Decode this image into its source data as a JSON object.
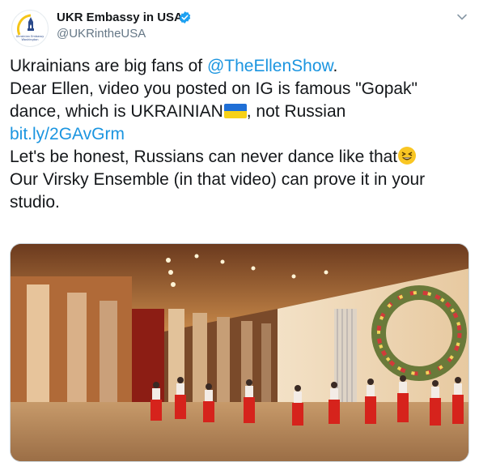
{
  "tweet": {
    "display_name": "UKR Embassy in USA",
    "handle": "@UKRintheUSA",
    "avatar_caption": "Ukrainian Embassy Washington",
    "text": {
      "line1_prefix": "Ukrainians are big fans of ",
      "mention": "@TheEllenShow",
      "line1_suffix": ".",
      "line2": "Dear Ellen, video you posted on IG is famous \"Gopak\"",
      "line3_prefix": "dance, which is UKRAINIAN",
      "line3_suffix": ", not Russian",
      "link": "bit.ly/2GAvGrm",
      "line5": "Let's be honest, Russians can never dance like that",
      "line6": "Our Virsky Ensemble (in that video) can prove it in your",
      "line7": "studio."
    },
    "emojis": [
      "ukraine-flag",
      "grinning-squinting-face"
    ],
    "media": {
      "type": "video",
      "description_icon": "video-thumbnail"
    }
  },
  "colors": {
    "text": "#14171a",
    "secondary": "#657786",
    "link": "#1b95e0",
    "verified": "#1da1f2",
    "flag_blue": "#1f6fd6",
    "flag_yellow": "#f7d117"
  }
}
